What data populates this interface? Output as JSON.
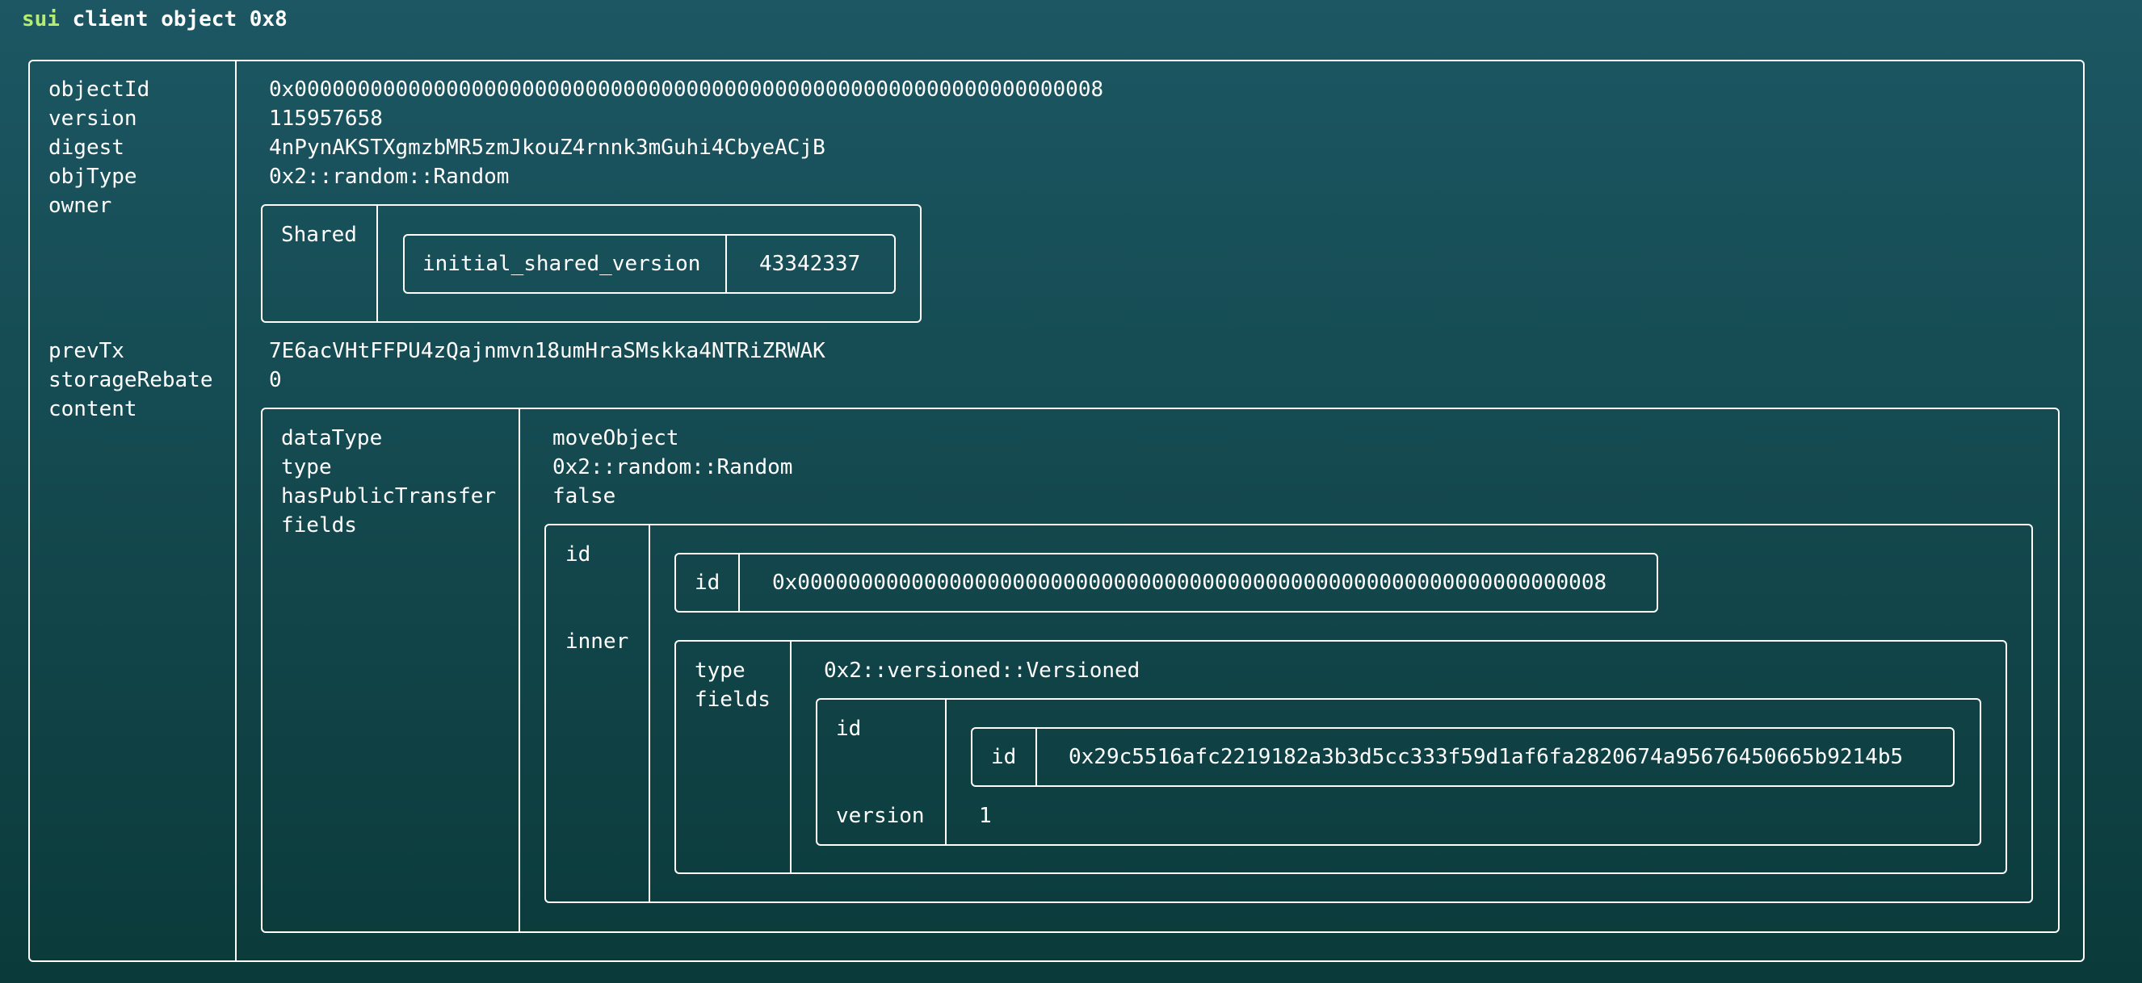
{
  "command": {
    "prefix": "sui",
    "rest": " client object 0x8"
  },
  "object": {
    "keys": {
      "objectId": "objectId",
      "version": "version",
      "digest": "digest",
      "objType": "objType",
      "owner": "owner",
      "prevTx": "prevTx",
      "storageRebate": "storageRebate",
      "content": "content"
    },
    "objectId": "0x0000000000000000000000000000000000000000000000000000000000000008",
    "version": "115957658",
    "digest": "4nPynAKSTXgmzbMR5zmJkouZ4rnnk3mGuhi4CbyeACjB",
    "objType": "0x2::random::Random",
    "owner": {
      "label": "Shared",
      "field_key": "initial_shared_version",
      "field_value": "43342337"
    },
    "prevTx": "7E6acVHtFFPU4zQajnmvn18umHraSMskka4NTRiZRWAK",
    "storageRebate": "0",
    "content": {
      "keys": {
        "dataType": "dataType",
        "type": "type",
        "hasPublicTransfer": "hasPublicTransfer",
        "fields": "fields"
      },
      "dataType": "moveObject",
      "type": "0x2::random::Random",
      "hasPublicTransfer": "false",
      "fields": {
        "id_key": "id",
        "inner_key": "inner",
        "id": {
          "key": "id",
          "value": "0x0000000000000000000000000000000000000000000000000000000000000008"
        },
        "inner": {
          "type_key": "type",
          "fields_key": "fields",
          "type": "0x2::versioned::Versioned",
          "fields": {
            "id_key": "id",
            "version_key": "version",
            "id": {
              "key": "id",
              "value": "0x29c5516afc2219182a3b3d5cc333f59d1af6fa2820674a95676450665b9214b5"
            },
            "version": "1"
          }
        }
      }
    }
  }
}
